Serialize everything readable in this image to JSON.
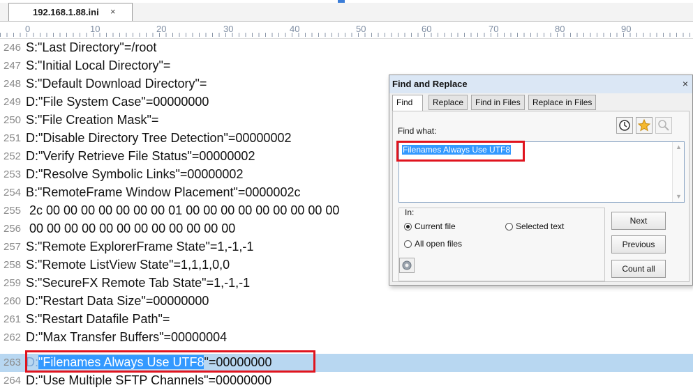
{
  "tab": {
    "title": "192.168.1.88.ini",
    "close": "×"
  },
  "ruler": {
    "labels": [
      "0",
      "10",
      "20",
      "30",
      "40",
      "50",
      "60",
      "70",
      "80",
      "90"
    ]
  },
  "lines": [
    {
      "num": "246",
      "text": "S:\"Last Directory\"=/root"
    },
    {
      "num": "247",
      "text": "S:\"Initial Local Directory\"="
    },
    {
      "num": "248",
      "text": "S:\"Default Download Directory\"="
    },
    {
      "num": "249",
      "text": "D:\"File System Case\"=00000000"
    },
    {
      "num": "250",
      "text": "S:\"File Creation Mask\"="
    },
    {
      "num": "251",
      "text": "D:\"Disable Directory Tree Detection\"=00000002"
    },
    {
      "num": "252",
      "text": "D:\"Verify Retrieve File Status\"=00000002"
    },
    {
      "num": "253",
      "text": "D:\"Resolve Symbolic Links\"=00000002"
    },
    {
      "num": "254",
      "text": "B:\"RemoteFrame Window Placement\"=0000002c"
    },
    {
      "num": "255",
      "text": " 2c 00 00 00 00 00 00 00 01 00 00 00 00 00 00 00 00 00"
    },
    {
      "num": "256",
      "text": " 00 00 00 00 00 00 00 00 00 00 00 00"
    },
    {
      "num": "257",
      "text": "S:\"Remote ExplorerFrame State\"=1,-1,-1"
    },
    {
      "num": "258",
      "text": "S:\"Remote ListView State\"=1,1,1,0,0"
    },
    {
      "num": "259",
      "text": "S:\"SecureFX Remote Tab State\"=1,-1,-1"
    },
    {
      "num": "260",
      "text": "D:\"Restart Data Size\"=00000000"
    },
    {
      "num": "261",
      "text": "S:\"Restart Datafile Path\"="
    },
    {
      "num": "262",
      "text": "D:\"Max Transfer Buffers\"=00000004"
    }
  ],
  "highlight_line": {
    "num": "263",
    "prefix": "D:",
    "quote_open": "\"",
    "selected": "Filenames Always Use UTF8",
    "rest": "\"=00000000"
  },
  "last_line": {
    "num": "264",
    "text": "D:\"Use Multiple SFTP Channels\"=00000000"
  },
  "dialog": {
    "title": "Find and Replace",
    "close": "×",
    "tabs": [
      "Find",
      "Replace",
      "Find in Files",
      "Replace in Files"
    ],
    "find_label": "Find what:",
    "find_value": "Filenames Always Use UTF8",
    "in_label": "In:",
    "radio_current": "Current file",
    "radio_selected": "Selected text",
    "radio_all": "All open files",
    "btn_next": "Next",
    "btn_previous": "Previous",
    "btn_count": "Count all",
    "icons": [
      "clock-icon",
      "star-icon",
      "magnifier-icon",
      "gear-icon"
    ]
  },
  "colors": {
    "highlight_row": "#b8d7f1",
    "selection": "#3399ff",
    "annotation_box": "#e0141e"
  }
}
